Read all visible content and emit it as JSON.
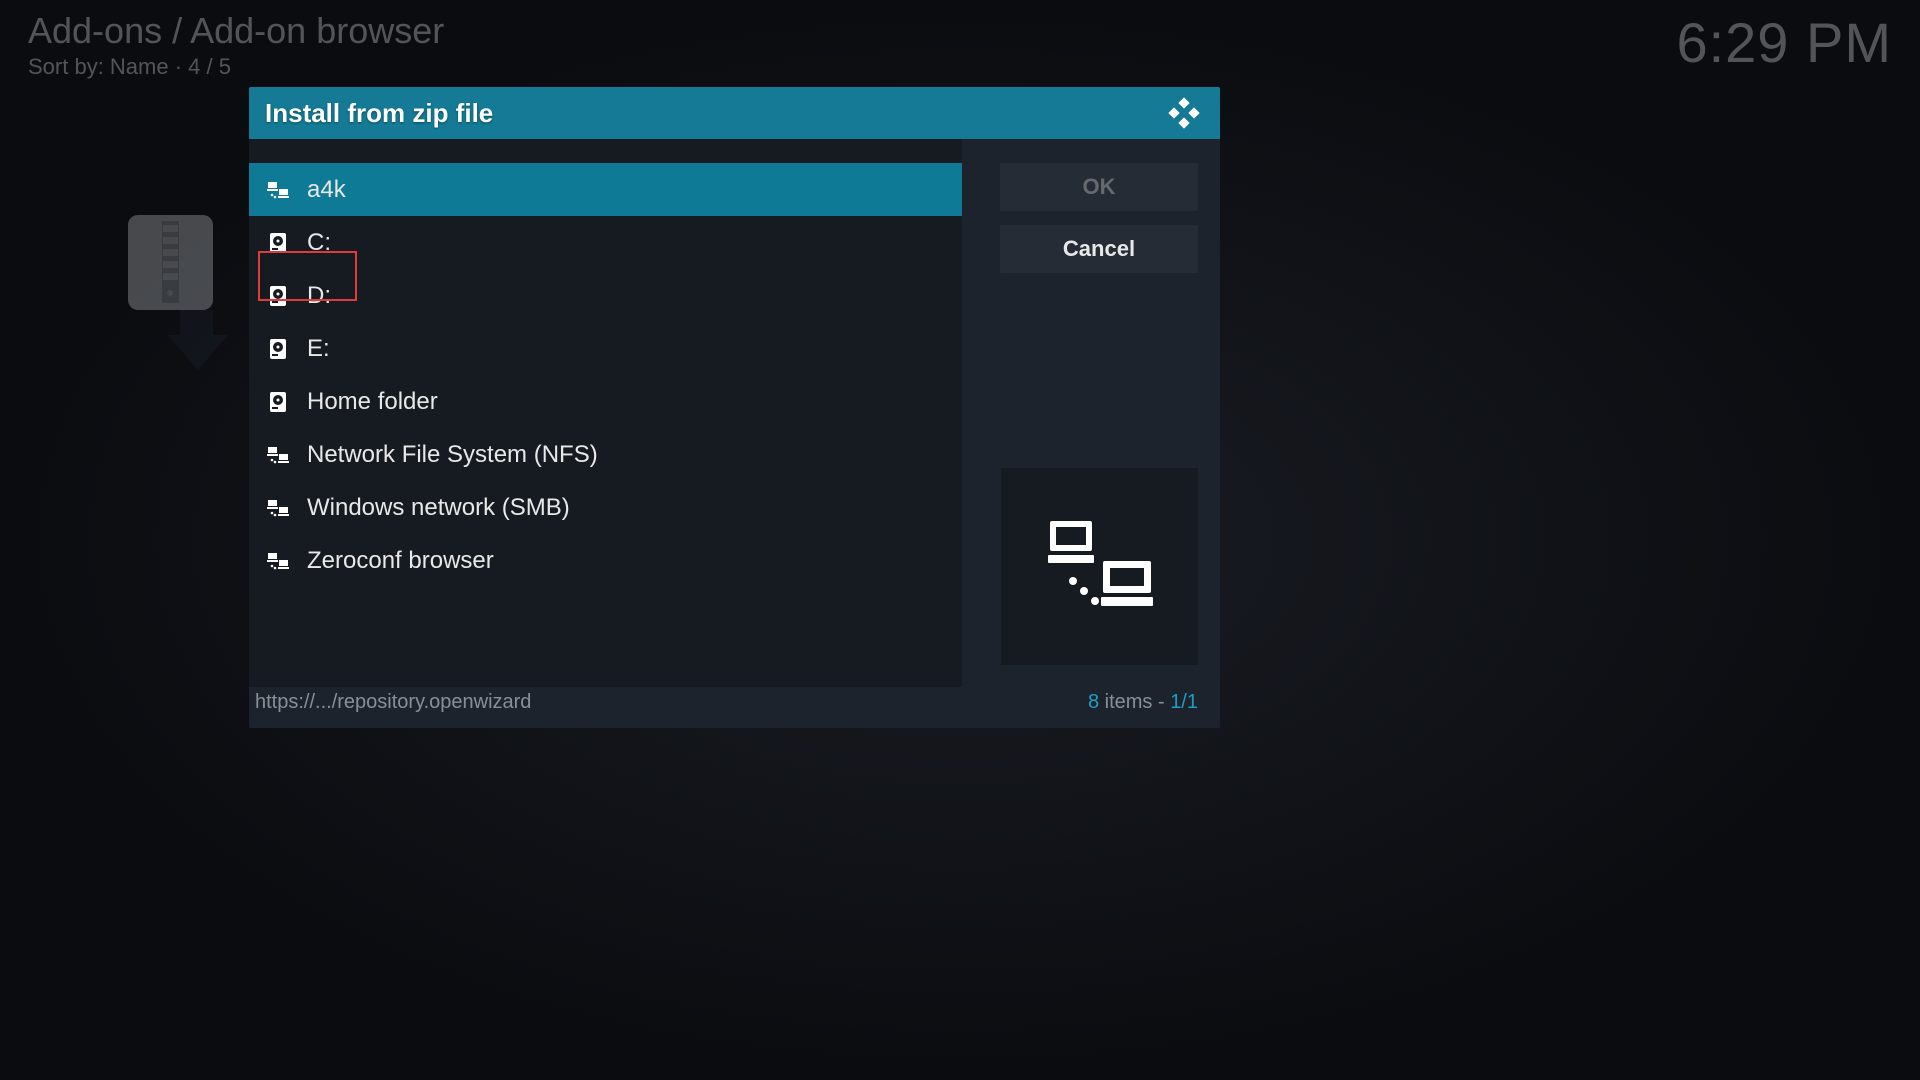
{
  "header": {
    "breadcrumb": "Add-ons / Add-on browser",
    "sort": "Sort by: Name  ·  4 / 5",
    "clock": "6:29 PM"
  },
  "dialog": {
    "title": "Install from zip file",
    "ok_label": "OK",
    "cancel_label": "Cancel",
    "path": "https://.../repository.openwizard",
    "count_accent": "8",
    "count_text": " items - ",
    "page_accent": "1/1",
    "items": [
      {
        "label": "a4k",
        "icon": "network",
        "selected": true
      },
      {
        "label": "C:",
        "icon": "drive",
        "selected": false
      },
      {
        "label": "D:",
        "icon": "drive",
        "selected": false
      },
      {
        "label": "E:",
        "icon": "drive",
        "selected": false
      },
      {
        "label": "Home folder",
        "icon": "drive",
        "selected": false
      },
      {
        "label": "Network File System (NFS)",
        "icon": "network",
        "selected": false
      },
      {
        "label": "Windows network (SMB)",
        "icon": "network",
        "selected": false
      },
      {
        "label": "Zeroconf browser",
        "icon": "network",
        "selected": false
      }
    ]
  }
}
